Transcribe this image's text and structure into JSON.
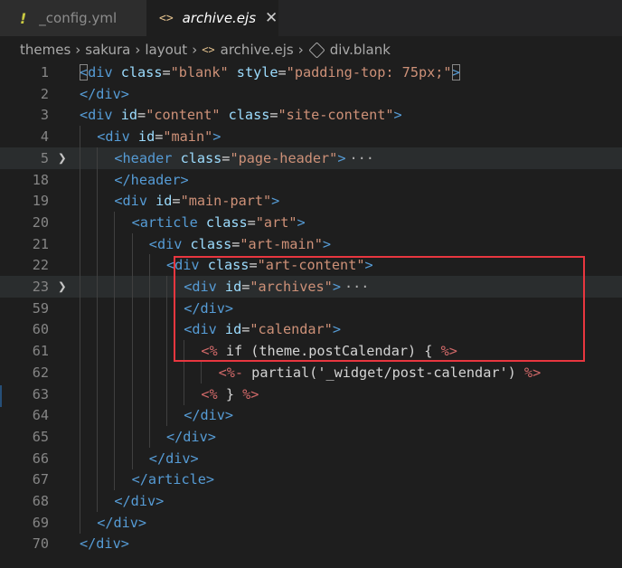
{
  "tabs": [
    {
      "name": "_config.yml",
      "icon": "!",
      "active": false
    },
    {
      "name": "archive.ejs",
      "icon": "<>",
      "active": true,
      "close": "✕"
    }
  ],
  "breadcrumbs": [
    "themes",
    "sakura",
    "layout",
    "archive.ejs",
    "div.blank"
  ],
  "lines": [
    {
      "n": "1",
      "indent": 0,
      "fold": false,
      "tokens": [
        [
          "tag",
          "<"
        ],
        [
          "tag",
          "div"
        ],
        [
          "txt",
          " "
        ],
        [
          "attr",
          "class"
        ],
        [
          "txt",
          "="
        ],
        [
          "str",
          "\"blank\""
        ],
        [
          "txt",
          " "
        ],
        [
          "attr",
          "style"
        ],
        [
          "txt",
          "="
        ],
        [
          "str",
          "\"padding-top: 75px;\""
        ],
        [
          "tag",
          ">"
        ]
      ]
    },
    {
      "n": "2",
      "indent": 0,
      "fold": false,
      "tokens": [
        [
          "tag",
          "</div>"
        ]
      ]
    },
    {
      "n": "3",
      "indent": 0,
      "fold": false,
      "tokens": [
        [
          "tag",
          "<div"
        ],
        [
          "txt",
          " "
        ],
        [
          "attr",
          "id"
        ],
        [
          "txt",
          "="
        ],
        [
          "str",
          "\"content\""
        ],
        [
          "txt",
          " "
        ],
        [
          "attr",
          "class"
        ],
        [
          "txt",
          "="
        ],
        [
          "str",
          "\"site-content\""
        ],
        [
          "tag",
          ">"
        ]
      ]
    },
    {
      "n": "4",
      "indent": 1,
      "fold": false,
      "tokens": [
        [
          "tag",
          "<div"
        ],
        [
          "txt",
          " "
        ],
        [
          "attr",
          "id"
        ],
        [
          "txt",
          "="
        ],
        [
          "str",
          "\"main\""
        ],
        [
          "tag",
          ">"
        ]
      ]
    },
    {
      "n": "5",
      "indent": 2,
      "fold": true,
      "tokens": [
        [
          "tag",
          "<header"
        ],
        [
          "txt",
          " "
        ],
        [
          "attr",
          "class"
        ],
        [
          "txt",
          "="
        ],
        [
          "str",
          "\"page-header\""
        ],
        [
          "tag",
          ">"
        ],
        [
          "ellipsis",
          "···"
        ]
      ]
    },
    {
      "n": "18",
      "indent": 2,
      "fold": false,
      "tokens": [
        [
          "tag",
          "</header>"
        ]
      ]
    },
    {
      "n": "19",
      "indent": 2,
      "fold": false,
      "tokens": [
        [
          "tag",
          "<div"
        ],
        [
          "txt",
          " "
        ],
        [
          "attr",
          "id"
        ],
        [
          "txt",
          "="
        ],
        [
          "str",
          "\"main-part\""
        ],
        [
          "tag",
          ">"
        ]
      ]
    },
    {
      "n": "20",
      "indent": 3,
      "fold": false,
      "tokens": [
        [
          "tag",
          "<article"
        ],
        [
          "txt",
          " "
        ],
        [
          "attr",
          "class"
        ],
        [
          "txt",
          "="
        ],
        [
          "str",
          "\"art\""
        ],
        [
          "tag",
          ">"
        ]
      ]
    },
    {
      "n": "21",
      "indent": 4,
      "fold": false,
      "tokens": [
        [
          "tag",
          "<div"
        ],
        [
          "txt",
          " "
        ],
        [
          "attr",
          "class"
        ],
        [
          "txt",
          "="
        ],
        [
          "str",
          "\"art-main\""
        ],
        [
          "tag",
          ">"
        ]
      ]
    },
    {
      "n": "22",
      "indent": 5,
      "fold": false,
      "tokens": [
        [
          "tag",
          "<div"
        ],
        [
          "txt",
          " "
        ],
        [
          "attr",
          "class"
        ],
        [
          "txt",
          "="
        ],
        [
          "str",
          "\"art-content\""
        ],
        [
          "tag",
          ">"
        ]
      ]
    },
    {
      "n": "23",
      "indent": 6,
      "fold": true,
      "tokens": [
        [
          "tag",
          "<div"
        ],
        [
          "txt",
          " "
        ],
        [
          "attr",
          "id"
        ],
        [
          "txt",
          "="
        ],
        [
          "str",
          "\"archives\""
        ],
        [
          "tag",
          ">"
        ],
        [
          "ellipsis",
          "···"
        ]
      ]
    },
    {
      "n": "59",
      "indent": 6,
      "fold": false,
      "tokens": [
        [
          "tag",
          "</div>"
        ]
      ]
    },
    {
      "n": "60",
      "indent": 6,
      "fold": false,
      "tokens": [
        [
          "tag",
          "<div"
        ],
        [
          "txt",
          " "
        ],
        [
          "attr",
          "id"
        ],
        [
          "txt",
          "="
        ],
        [
          "str",
          "\"calendar\""
        ],
        [
          "tag",
          ">"
        ]
      ]
    },
    {
      "n": "61",
      "indent": 7,
      "fold": false,
      "tokens": [
        [
          "ejs",
          "<%"
        ],
        [
          "txt",
          " if (theme.postCalendar) { "
        ],
        [
          "ejs",
          "%>"
        ]
      ]
    },
    {
      "n": "62",
      "indent": 8,
      "fold": false,
      "tokens": [
        [
          "ejs",
          "<%-"
        ],
        [
          "txt",
          " partial('_widget/post-calendar') "
        ],
        [
          "ejs",
          "%>"
        ]
      ]
    },
    {
      "n": "63",
      "indent": 7,
      "fold": false,
      "tokens": [
        [
          "ejs",
          "<%"
        ],
        [
          "txt",
          " } "
        ],
        [
          "ejs",
          "%>"
        ]
      ]
    },
    {
      "n": "64",
      "indent": 6,
      "fold": false,
      "tokens": [
        [
          "tag",
          "</div>"
        ]
      ]
    },
    {
      "n": "65",
      "indent": 5,
      "fold": false,
      "tokens": [
        [
          "tag",
          "</div>"
        ]
      ]
    },
    {
      "n": "66",
      "indent": 4,
      "fold": false,
      "tokens": [
        [
          "tag",
          "</div>"
        ]
      ]
    },
    {
      "n": "67",
      "indent": 3,
      "fold": false,
      "tokens": [
        [
          "tag",
          "</article>"
        ]
      ]
    },
    {
      "n": "68",
      "indent": 2,
      "fold": false,
      "tokens": [
        [
          "tag",
          "</div>"
        ]
      ]
    },
    {
      "n": "69",
      "indent": 1,
      "fold": false,
      "tokens": [
        [
          "tag",
          "</div>"
        ]
      ]
    },
    {
      "n": "70",
      "indent": 0,
      "fold": false,
      "tokens": [
        [
          "tag",
          "</div>"
        ]
      ]
    }
  ],
  "colors": {
    "tag": "#569cd6",
    "attr": "#9cdcfe",
    "string": "#ce9178",
    "ejs": "#d16969",
    "highlight": "#e8363f"
  },
  "fold_icon": "chevron-right-icon"
}
